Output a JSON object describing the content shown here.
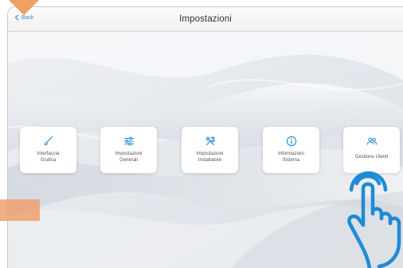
{
  "header": {
    "back_label": "Back",
    "title": "Impostazioni"
  },
  "cards": [
    {
      "label": "Interfaccia Grafica",
      "icon": "brush-icon"
    },
    {
      "label": "Impostazioni Generali",
      "icon": "sliders-icon"
    },
    {
      "label": "Impostazioni Installatore",
      "icon": "tools-icon"
    },
    {
      "label": "Informazioni Sistema",
      "icon": "info-icon"
    },
    {
      "label": "Gestione Utenti",
      "icon": "users-icon"
    }
  ],
  "colors": {
    "accent": "#1e8bd6",
    "back_link": "#3a86d8",
    "overlay": "#ef924d",
    "hand_outline": "#1e8bd6"
  },
  "overlays": {
    "pointer_icon": "tap-hand-icon"
  }
}
